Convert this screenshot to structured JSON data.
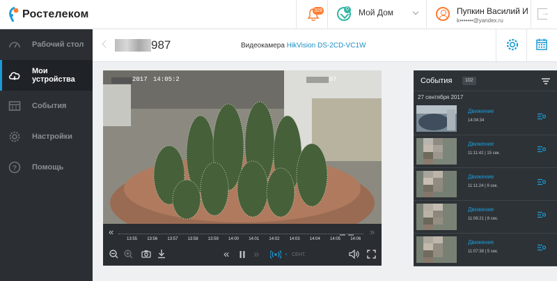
{
  "header": {
    "brand": "Ростелеком",
    "notifications_count": "328",
    "home_badge": "0",
    "home_label": "Мой Дом",
    "user_name": "Пупкин Василий И",
    "user_email": "k•••••••@yandex.ru"
  },
  "sidebar": {
    "items": [
      {
        "label": "Рабочий стол",
        "icon": "gauge-icon"
      },
      {
        "label": "Мои устройства",
        "icon": "cloud-icon"
      },
      {
        "label": "События",
        "icon": "calendar-grid-icon"
      },
      {
        "label": "Настройки",
        "icon": "gear-icon"
      },
      {
        "label": "Помощь",
        "icon": "question-icon"
      }
    ]
  },
  "camera": {
    "number": "987",
    "title_prefix": "Видеокамера",
    "model": "HikVision DS-2CD-VC1W"
  },
  "video_overlay": {
    "date_text": "2017",
    "time_text": "14:05:2",
    "cam_id_text": "07"
  },
  "timeline": {
    "labels": [
      "13:55",
      "13:56",
      "13:57",
      "13:58",
      "13:59",
      "14:00",
      "14:01",
      "14:02",
      "14:03",
      "14:04",
      "14:05",
      "14:06"
    ],
    "speed_text": "СЕНТ."
  },
  "events": {
    "title": "События",
    "count": "102",
    "date": "27 сентября 2017",
    "items": [
      {
        "type": "Движение",
        "time": "14:04:34"
      },
      {
        "type": "Движение",
        "time": "11:11:42  | 15 сек."
      },
      {
        "type": "Движение",
        "time": "11:11:24  | 9 сек."
      },
      {
        "type": "Движение",
        "time": "11:08:21  | 8 сек."
      },
      {
        "type": "Движение",
        "time": "11:07:38  | 5 сек."
      }
    ]
  },
  "colors": {
    "accent": "#1a9bd7",
    "brand_orange": "#ff7a2f",
    "sidebar_bg": "#2b2f33"
  }
}
